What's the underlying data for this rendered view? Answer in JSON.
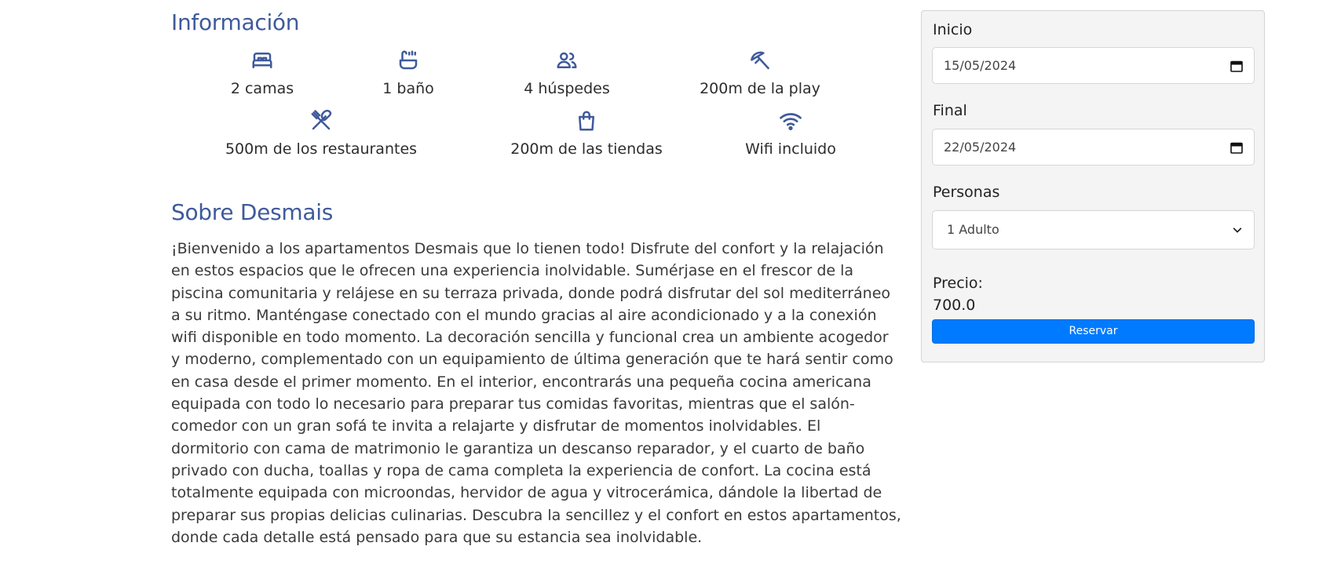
{
  "info": {
    "title": "Información",
    "features": [
      {
        "icon": "bed-icon",
        "label": "2 camas"
      },
      {
        "icon": "bathtub-icon",
        "label": "1 baño"
      },
      {
        "icon": "people-icon",
        "label": "4 húspedes"
      },
      {
        "icon": "beach-umbrella-icon",
        "label": "200m de la play"
      },
      {
        "icon": "fork-knife-icon",
        "label": "500m de los restaurantes"
      },
      {
        "icon": "shopping-bag-icon",
        "label": "200m de las tiendas"
      },
      {
        "icon": "wifi-icon",
        "label": "Wifi incluido"
      }
    ]
  },
  "about": {
    "title": "Sobre Desmais",
    "text": "¡Bienvenido a los apartamentos Desmais que lo tienen todo! Disfrute del confort y la relajación en estos espacios que le ofrecen una experiencia inolvidable. Sumérjase en el frescor de la piscina comunitaria y relájese en su terraza privada, donde podrá disfrutar del sol mediterráneo a su ritmo. Manténgase conectado con el mundo gracias al aire acondicionado y a la conexión wifi disponible en todo momento. La decoración sencilla y funcional crea un ambiente acogedor y moderno, complementado con un equipamiento de última generación que te hará sentir como en casa desde el primer momento. En el interior, encontrarás una pequeña cocina americana equipada con todo lo necesario para preparar tus comidas favoritas, mientras que el salón-comedor con un gran sofá te invita a relajarte y disfrutar de momentos inolvidables. El dormitorio con cama de matrimonio le garantiza un descanso reparador, y el cuarto de baño privado con ducha, toallas y ropa de cama completa la experiencia de confort. La cocina está totalmente equipada con microondas, hervidor de agua y vitrocerámica, dándole la libertad de preparar sus propias delicias culinarias. Descubra la sencillez y el confort en estos apartamentos, donde cada detalle está pensado para que su estancia sea inolvidable."
  },
  "booking": {
    "start_label": "Inicio",
    "start_value": "15/05/2024",
    "end_label": "Final",
    "end_value": "22/05/2024",
    "people_label": "Personas",
    "people_selected": "1 Adulto",
    "price_label": "Precio:",
    "price_value": "700.0",
    "reserve_label": "Reservar"
  },
  "colors": {
    "heading": "#3f5a9b",
    "accent": "#007bff",
    "panel_bg": "#f4f4f4"
  }
}
